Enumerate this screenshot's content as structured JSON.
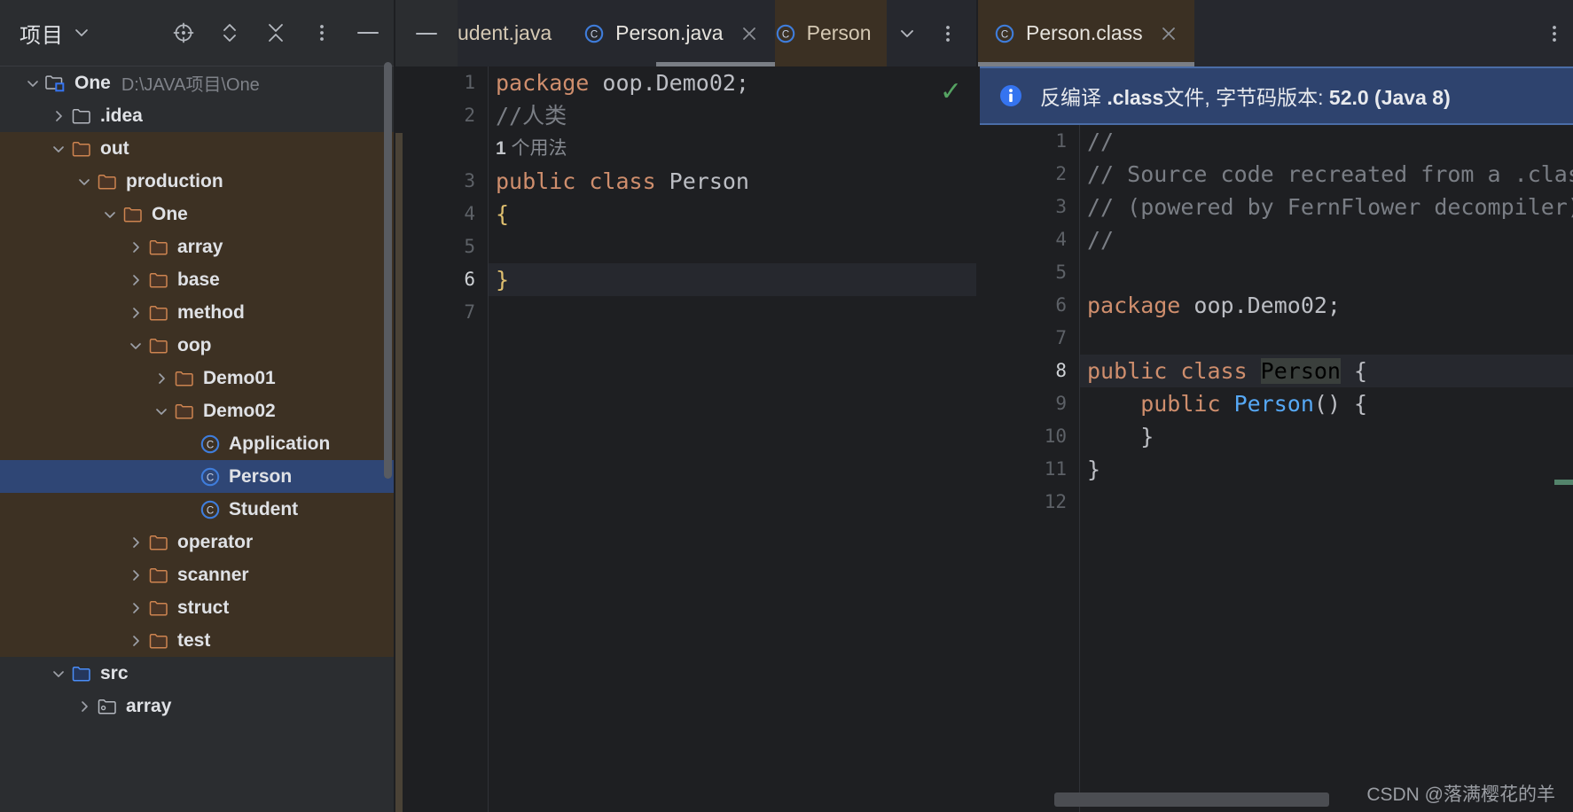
{
  "project_panel": {
    "title": "项目",
    "title_chevron_icon": "chevron-down-icon",
    "toolbar_icons": [
      {
        "name": "select-opened-file-icon",
        "glyph": "locate"
      },
      {
        "name": "expand-collapse-icon",
        "glyph": "updown"
      },
      {
        "name": "collapse-all-icon",
        "glyph": "collapse"
      },
      {
        "name": "more-options-icon",
        "glyph": "kebab"
      },
      {
        "name": "hide-tool-window-icon",
        "glyph": "minus"
      }
    ],
    "tree": [
      {
        "depth": 0,
        "arrow": "down",
        "icon": "project-module-icon",
        "label": "One",
        "sub": "D:\\JAVA项目\\One",
        "state": "normal"
      },
      {
        "depth": 1,
        "arrow": "right",
        "icon": "folder-gray-icon",
        "label": ".idea",
        "sub": "",
        "state": "normal"
      },
      {
        "depth": 1,
        "arrow": "down",
        "icon": "folder-orange-icon",
        "label": "out",
        "sub": "",
        "state": "excluded"
      },
      {
        "depth": 2,
        "arrow": "down",
        "icon": "folder-orange-icon",
        "label": "production",
        "sub": "",
        "state": "excluded"
      },
      {
        "depth": 3,
        "arrow": "down",
        "icon": "folder-orange-icon",
        "label": "One",
        "sub": "",
        "state": "excluded"
      },
      {
        "depth": 4,
        "arrow": "right",
        "icon": "folder-orange-icon",
        "label": "array",
        "sub": "",
        "state": "excluded"
      },
      {
        "depth": 4,
        "arrow": "right",
        "icon": "folder-orange-icon",
        "label": "base",
        "sub": "",
        "state": "excluded"
      },
      {
        "depth": 4,
        "arrow": "right",
        "icon": "folder-orange-icon",
        "label": "method",
        "sub": "",
        "state": "excluded"
      },
      {
        "depth": 4,
        "arrow": "down",
        "icon": "folder-orange-icon",
        "label": "oop",
        "sub": "",
        "state": "excluded"
      },
      {
        "depth": 5,
        "arrow": "right",
        "icon": "folder-orange-icon",
        "label": "Demo01",
        "sub": "",
        "state": "excluded"
      },
      {
        "depth": 5,
        "arrow": "down",
        "icon": "folder-orange-icon",
        "label": "Demo02",
        "sub": "",
        "state": "excluded"
      },
      {
        "depth": 6,
        "arrow": "none",
        "icon": "java-class-icon",
        "label": "Application",
        "sub": "",
        "state": "excluded"
      },
      {
        "depth": 6,
        "arrow": "none",
        "icon": "java-class-icon",
        "label": "Person",
        "sub": "",
        "state": "selected"
      },
      {
        "depth": 6,
        "arrow": "none",
        "icon": "java-class-icon",
        "label": "Student",
        "sub": "",
        "state": "excluded"
      },
      {
        "depth": 4,
        "arrow": "right",
        "icon": "folder-orange-icon",
        "label": "operator",
        "sub": "",
        "state": "excluded"
      },
      {
        "depth": 4,
        "arrow": "right",
        "icon": "folder-orange-icon",
        "label": "scanner",
        "sub": "",
        "state": "excluded"
      },
      {
        "depth": 4,
        "arrow": "right",
        "icon": "folder-orange-icon",
        "label": "struct",
        "sub": "",
        "state": "excluded"
      },
      {
        "depth": 4,
        "arrow": "right",
        "icon": "folder-orange-icon",
        "label": "test",
        "sub": "",
        "state": "excluded"
      },
      {
        "depth": 1,
        "arrow": "down",
        "icon": "folder-blue-icon",
        "label": "src",
        "sub": "",
        "state": "normal"
      },
      {
        "depth": 2,
        "arrow": "right",
        "icon": "package-icon",
        "label": "array",
        "sub": "",
        "state": "normal"
      }
    ]
  },
  "left_editor": {
    "tabs": [
      {
        "label": "udent.java",
        "icon": "",
        "closable": false,
        "active": false,
        "clipped": true
      },
      {
        "label": "Person.java",
        "icon": "java-class-icon",
        "closable": true,
        "active": true,
        "clipped": false
      },
      {
        "label": "Person",
        "icon": "java-class-icon",
        "closable": false,
        "active": false,
        "clipped": true,
        "brown": true
      }
    ],
    "tab_controls": [
      {
        "name": "tab-list-dropdown-icon",
        "glyph": "chevron"
      },
      {
        "name": "editor-options-icon",
        "glyph": "kebab"
      }
    ],
    "inspection_status": "✓",
    "lines": [
      {
        "num": "1",
        "current": false,
        "tokens": [
          {
            "t": "package ",
            "c": "kw"
          },
          {
            "t": "oop.Demo02;",
            "c": "ident"
          }
        ]
      },
      {
        "num": "2",
        "current": false,
        "tokens": [
          {
            "t": "//人类",
            "c": "cmt"
          }
        ]
      },
      {
        "num": "",
        "current": false,
        "hint": "1 个用法",
        "hint_bold": "1"
      },
      {
        "num": "3",
        "current": false,
        "tokens": [
          {
            "t": "public class ",
            "c": "kw"
          },
          {
            "t": "Person",
            "c": "ident"
          }
        ]
      },
      {
        "num": "4",
        "current": false,
        "tokens": [
          {
            "t": "{",
            "c": "brace"
          }
        ]
      },
      {
        "num": "5",
        "current": false,
        "tokens": [
          {
            "t": "",
            "c": "ident"
          }
        ]
      },
      {
        "num": "6",
        "current": true,
        "tokens": [
          {
            "t": "}",
            "c": "brace"
          }
        ]
      },
      {
        "num": "7",
        "current": false,
        "tokens": [
          {
            "t": "",
            "c": "ident"
          }
        ]
      }
    ]
  },
  "right_editor": {
    "tabs": [
      {
        "label": "Person.class",
        "icon": "java-class-icon",
        "closable": true,
        "active": true
      }
    ],
    "kebab_icon": "editor-options-icon",
    "banner": {
      "icon": "info-icon",
      "prefix": "反编译 ",
      "bold1": ".class",
      "mid": "文件, 字节码版本: ",
      "bold2": "52.0 (Java 8)"
    },
    "lines": [
      {
        "num": "1",
        "current": false,
        "tokens": [
          {
            "t": "//",
            "c": "cmt"
          }
        ]
      },
      {
        "num": "2",
        "current": false,
        "tokens": [
          {
            "t": "// Source code recreated from a .clas",
            "c": "cmt"
          }
        ]
      },
      {
        "num": "3",
        "current": false,
        "tokens": [
          {
            "t": "// (powered by FernFlower decompiler)",
            "c": "cmt"
          }
        ]
      },
      {
        "num": "4",
        "current": false,
        "tokens": [
          {
            "t": "//",
            "c": "cmt"
          }
        ]
      },
      {
        "num": "5",
        "current": false,
        "tokens": [
          {
            "t": "",
            "c": "ident"
          }
        ]
      },
      {
        "num": "6",
        "current": false,
        "tokens": [
          {
            "t": "package ",
            "c": "kw"
          },
          {
            "t": "oop.Demo02;",
            "c": "ident"
          }
        ]
      },
      {
        "num": "7",
        "current": false,
        "tokens": [
          {
            "t": "",
            "c": "ident"
          }
        ]
      },
      {
        "num": "8",
        "current": true,
        "tokens": [
          {
            "t": "public class ",
            "c": "kw"
          },
          {
            "t": "Person",
            "c": "hl-ident"
          },
          {
            "t": " {",
            "c": "ident"
          }
        ]
      },
      {
        "num": "9",
        "current": false,
        "tokens": [
          {
            "t": "    public ",
            "c": "kw"
          },
          {
            "t": "Person",
            "c": "ctor"
          },
          {
            "t": "() {",
            "c": "ident"
          }
        ]
      },
      {
        "num": "10",
        "current": false,
        "tokens": [
          {
            "t": "    }",
            "c": "ident"
          }
        ]
      },
      {
        "num": "11",
        "current": false,
        "tokens": [
          {
            "t": "}",
            "c": "ident"
          }
        ]
      },
      {
        "num": "12",
        "current": false,
        "tokens": [
          {
            "t": "",
            "c": "ident"
          }
        ]
      }
    ]
  },
  "watermark": "CSDN @落满樱花的羊",
  "colors": {
    "panel_bg": "#2b2d30",
    "editor_bg": "#1e1f22",
    "excluded_bg": "#3d3123",
    "selection_bg": "#2f4675",
    "banner_bg": "#2e436e",
    "banner_border": "#4a6da7",
    "keyword": "#cf8e6d",
    "comment": "#7a7e85",
    "brace": "#dfbf6f",
    "class_icon": "#3f7ddb",
    "folder_orange": "#cd8450",
    "folder_blue": "#4a8df8",
    "check_green": "#55a362"
  }
}
